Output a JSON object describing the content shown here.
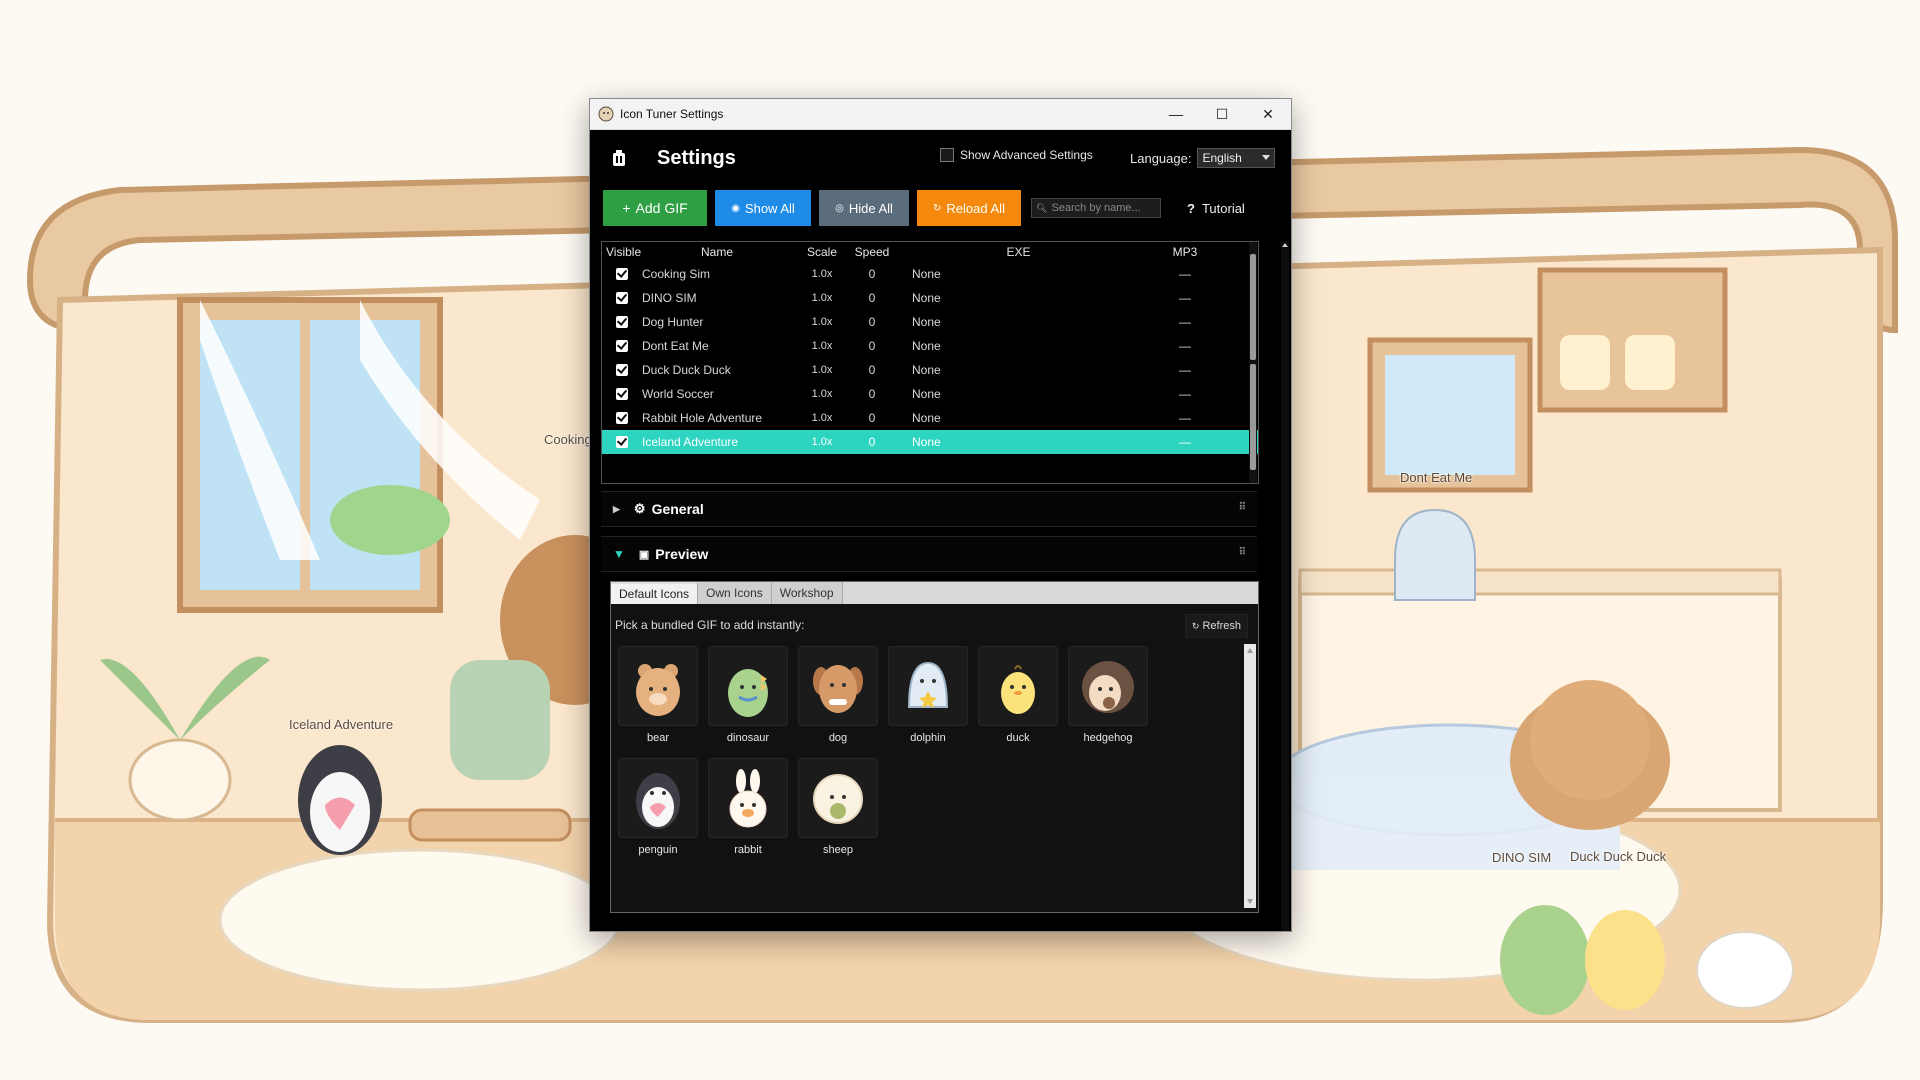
{
  "window": {
    "title": "Icon Tuner Settings",
    "controls": {
      "minimize": "—",
      "maximize": "☐",
      "close": "✕"
    }
  },
  "header": {
    "title": "Settings",
    "show_advanced_label": "Show Advanced Settings",
    "language_label": "Language:",
    "language_value": "English"
  },
  "toolbar": {
    "add_gif": "Add GIF",
    "show_all": "Show All",
    "hide_all": "Hide All",
    "reload_all": "Reload All",
    "search_placeholder": "Search by name...",
    "tutorial": "Tutorial"
  },
  "table": {
    "columns": [
      "Visible",
      "Name",
      "Scale",
      "Speed",
      "EXE",
      "MP3"
    ],
    "rows": [
      {
        "visible": true,
        "name": "Cooking Sim",
        "scale": "1.0x",
        "speed": "0",
        "exe": "None",
        "mp3": "—"
      },
      {
        "visible": true,
        "name": "DINO SIM",
        "scale": "1.0x",
        "speed": "0",
        "exe": "None",
        "mp3": "—"
      },
      {
        "visible": true,
        "name": "Dog Hunter",
        "scale": "1.0x",
        "speed": "0",
        "exe": "None",
        "mp3": "—"
      },
      {
        "visible": true,
        "name": "Dont Eat Me",
        "scale": "1.0x",
        "speed": "0",
        "exe": "None",
        "mp3": "—"
      },
      {
        "visible": true,
        "name": "Duck Duck Duck",
        "scale": "1.0x",
        "speed": "0",
        "exe": "None",
        "mp3": "—"
      },
      {
        "visible": true,
        "name": "World Soccer",
        "scale": "1.0x",
        "speed": "0",
        "exe": "None",
        "mp3": "—"
      },
      {
        "visible": true,
        "name": "Rabbit Hole Adventure",
        "scale": "1.0x",
        "speed": "0",
        "exe": "None",
        "mp3": "—"
      },
      {
        "visible": true,
        "name": "Iceland Adventure",
        "scale": "1.0x",
        "speed": "0",
        "exe": "None",
        "mp3": "—"
      }
    ],
    "selected_row_color": "#2dd4bf"
  },
  "sections": {
    "general": "General",
    "preview": "Preview"
  },
  "preview": {
    "tabs": [
      "Default Icons",
      "Own Icons",
      "Workshop"
    ],
    "active_tab": "Default Icons",
    "hint": "Pick a bundled GIF to add instantly:",
    "refresh": "Refresh",
    "icons": [
      "bear",
      "dinosaur",
      "dog",
      "dolphin",
      "duck",
      "hedgehog",
      "penguin",
      "rabbit",
      "sheep"
    ]
  },
  "desktop": {
    "labels": {
      "cooking": "Cooking",
      "dont_eat_me": "Dont Eat Me",
      "iceland": "Iceland Adventure",
      "dino": "DINO SIM",
      "duck": "Duck Duck Duck"
    }
  },
  "colors": {
    "add": "#2ea043",
    "show": "#1e8ce6",
    "hide": "#5b6c7c",
    "reload": "#f5890e",
    "accent": "#2dd4bf"
  }
}
